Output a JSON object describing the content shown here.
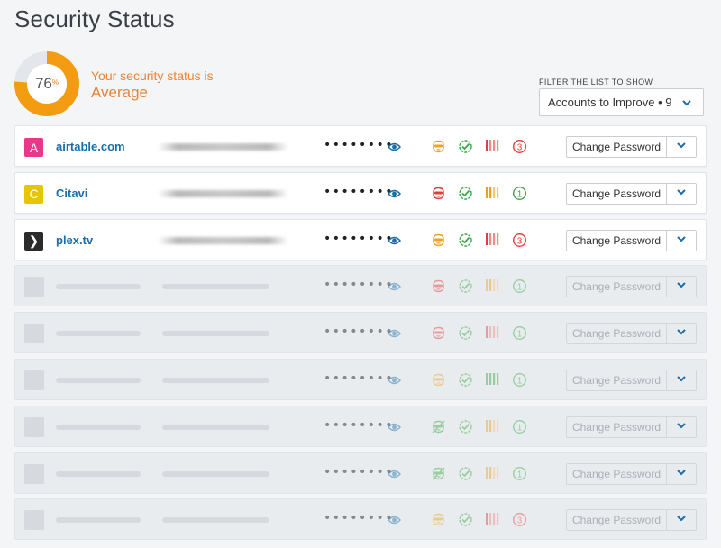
{
  "page": {
    "title": "Security Status"
  },
  "summary": {
    "score": "76",
    "score_unit": "%",
    "score_fraction": 0.76,
    "line1": "Your security status is",
    "line2": "Average",
    "accent": "#f39c12"
  },
  "filter": {
    "label": "FILTER THE LIST TO SHOW",
    "selected": "Accounts to Improve • 9"
  },
  "password_mask": "••••••••",
  "change_password_label": "Change Password",
  "accounts": [
    {
      "name": "airtable.com",
      "icon_letter": "A",
      "icon_color": "#e8388a",
      "mask": "orange",
      "check": "green",
      "strength": "red",
      "count": "3",
      "count_color": "red"
    },
    {
      "name": "Citavi",
      "icon_letter": "C",
      "icon_color": "#e5c600",
      "mask": "red",
      "check": "green",
      "strength": "orange",
      "count": "1",
      "count_color": "green"
    },
    {
      "name": "plex.tv",
      "icon_letter": "❯",
      "icon_color": "#2b2b2b",
      "mask": "orange",
      "check": "green",
      "strength": "red",
      "count": "3",
      "count_color": "red"
    },
    {
      "mask": "red",
      "check": "green",
      "strength": "orange",
      "count": "1",
      "count_color": "green"
    },
    {
      "mask": "red",
      "check": "green",
      "strength": "red",
      "count": "1",
      "count_color": "green"
    },
    {
      "mask": "orange",
      "check": "green",
      "strength": "green",
      "count": "1",
      "count_color": "green"
    },
    {
      "mask": "green-crossed",
      "check": "green",
      "strength": "orange",
      "count": "1",
      "count_color": "green"
    },
    {
      "mask": "green-crossed",
      "check": "green",
      "strength": "orange",
      "count": "1",
      "count_color": "green"
    },
    {
      "mask": "orange",
      "check": "green",
      "strength": "red",
      "count": "3",
      "count_color": "red"
    }
  ],
  "colors": {
    "red": "#e23b3b",
    "orange": "#f0a020",
    "green": "#3aa845",
    "link_blue": "#1a6ea8"
  },
  "icons": {
    "mask": "mask-icon",
    "check": "check-badge-icon",
    "strength": "strength-bars-icon",
    "count": "circled-count-icon",
    "eye": "eye-icon",
    "chevron": "chevron-down-icon"
  }
}
